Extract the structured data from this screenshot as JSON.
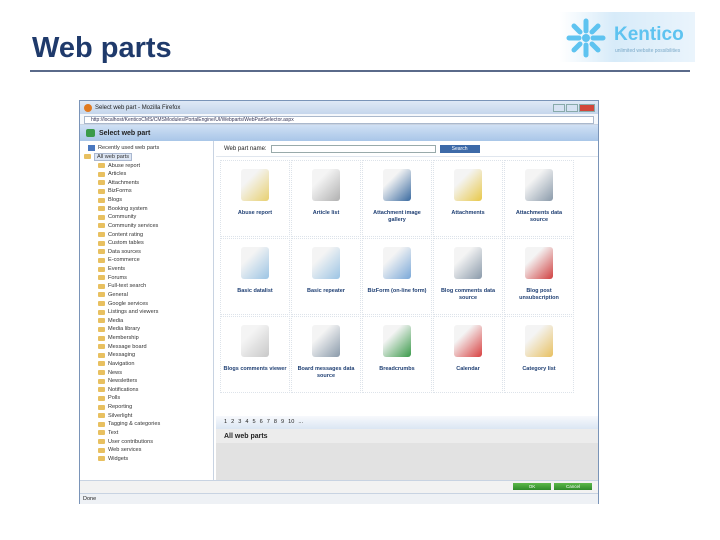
{
  "slide": {
    "title": "Web parts"
  },
  "logo": {
    "name": "Kentico",
    "tagline": "unlimited website possibilities"
  },
  "browser": {
    "title": "Select web part - Mozilla Firefox",
    "url": "http://localhost/KenticoCMS/CMSModules/PortalEngine/UI/Webparts/WebPartSelector.aspx",
    "status": "Done"
  },
  "dialog": {
    "header": "Select web part",
    "search_label": "Web part name:",
    "search_value": "",
    "search_button": "Search",
    "ok": "OK",
    "cancel": "Cancel",
    "category_title": "All web parts"
  },
  "tree": {
    "recent": "Recently used web parts",
    "root": "All web parts",
    "items": [
      "Abuse report",
      "Articles",
      "Attachments",
      "BizForms",
      "Blogs",
      "Booking system",
      "Community",
      "Community services",
      "Content rating",
      "Custom tables",
      "Data sources",
      "E-commerce",
      "Events",
      "Forums",
      "Full-text search",
      "General",
      "Google services",
      "Listings and viewers",
      "Media",
      "Media library",
      "Membership",
      "Message board",
      "Messaging",
      "Navigation",
      "News",
      "Newsletters",
      "Notifications",
      "Polls",
      "Reporting",
      "Silverlight",
      "Tagging & categories",
      "Text",
      "User contributions",
      "Web services",
      "Widgets"
    ]
  },
  "webparts": [
    {
      "label": "Abuse report",
      "icon": "abuse-report-icon",
      "color": "#e8d070"
    },
    {
      "label": "Article list",
      "icon": "article-list-icon",
      "color": "#b0b0b0"
    },
    {
      "label": "Attachment image gallery",
      "icon": "image-gallery-icon",
      "color": "#3a6aa0"
    },
    {
      "label": "Attachments",
      "icon": "attachments-icon",
      "color": "#e8c84a"
    },
    {
      "label": "Attachments data source",
      "icon": "database-icon",
      "color": "#8a9aaa"
    },
    {
      "label": "Basic datalist",
      "icon": "datalist-icon",
      "color": "#9cc4e4"
    },
    {
      "label": "Basic repeater",
      "icon": "repeater-icon",
      "color": "#9cc4e4"
    },
    {
      "label": "BizForm (on-line form)",
      "icon": "form-icon",
      "color": "#7aa8d8"
    },
    {
      "label": "Blog comments data source",
      "icon": "database-icon",
      "color": "#8a9aaa"
    },
    {
      "label": "Blog post unsubscription",
      "icon": "unsubscribe-icon",
      "color": "#d04040"
    },
    {
      "label": "Blogs comments viewer",
      "icon": "comments-viewer-icon",
      "color": "#c8c8c8"
    },
    {
      "label": "Board messages data source",
      "icon": "database-icon",
      "color": "#8a9aaa"
    },
    {
      "label": "Breadcrumbs",
      "icon": "signpost-icon",
      "color": "#3a9a4a"
    },
    {
      "label": "Calendar",
      "icon": "calendar-icon",
      "color": "#d84040"
    },
    {
      "label": "Category list",
      "icon": "folder-icon",
      "color": "#e8c060"
    }
  ],
  "pager": [
    "1",
    "2",
    "3",
    "4",
    "5",
    "6",
    "7",
    "8",
    "9",
    "10",
    "..."
  ]
}
